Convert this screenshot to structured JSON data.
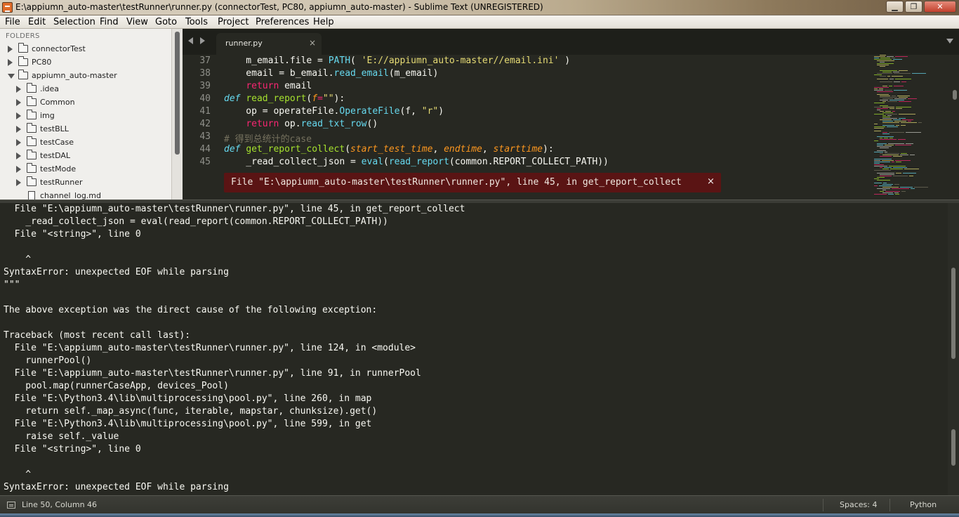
{
  "window": {
    "title": "E:\\appiumn_auto-master\\testRunner\\runner.py (connectorTest, PC80, appiumn_auto-master) - Sublime Text (UNREGISTERED)",
    "min_label": "▁",
    "max_label": "❐",
    "close_label": "✕"
  },
  "menu": [
    "File",
    "Edit",
    "Selection",
    "Find",
    "View",
    "Goto",
    "Tools",
    "Project",
    "Preferences",
    "Help"
  ],
  "sidebar": {
    "header": "FOLDERS",
    "items": [
      {
        "label": "connectorTest",
        "type": "folder",
        "state": "closed"
      },
      {
        "label": "PC80",
        "type": "folder",
        "state": "closed"
      },
      {
        "label": "appiumn_auto-master",
        "type": "folder",
        "state": "open"
      },
      {
        "label": ".idea",
        "type": "folder",
        "state": "closed"
      },
      {
        "label": "Common",
        "type": "folder",
        "state": "closed"
      },
      {
        "label": "img",
        "type": "folder",
        "state": "closed"
      },
      {
        "label": "testBLL",
        "type": "folder",
        "state": "closed"
      },
      {
        "label": "testCase",
        "type": "folder",
        "state": "closed"
      },
      {
        "label": "testDAL",
        "type": "folder",
        "state": "closed"
      },
      {
        "label": "testMode",
        "type": "folder",
        "state": "closed"
      },
      {
        "label": "testRunner",
        "type": "folder",
        "state": "closed"
      },
      {
        "label": "channel_log.md",
        "type": "file",
        "state": "none"
      }
    ]
  },
  "editor": {
    "tab": {
      "label": "runner.py",
      "close": "×"
    },
    "lines": [
      {
        "n": "37",
        "tokens": [
          [
            "    m_email.file = ",
            ""
          ],
          [
            "PATH",
            "cls"
          ],
          [
            "( ",
            ""
          ],
          [
            "'E://appiumn_auto-master//email.ini'",
            "str"
          ],
          [
            " )",
            ""
          ]
        ]
      },
      {
        "n": "38",
        "tokens": [
          [
            "    email = b_email.",
            ""
          ],
          [
            "read_email",
            "cls"
          ],
          [
            "(m_email)",
            ""
          ]
        ]
      },
      {
        "n": "39",
        "tokens": [
          [
            "    ",
            ""
          ],
          [
            "return",
            "kw"
          ],
          [
            " email",
            ""
          ]
        ]
      },
      {
        "n": "40",
        "tokens": [
          [
            "def",
            "kwd"
          ],
          [
            " ",
            ""
          ],
          [
            "read_report",
            "fn"
          ],
          [
            "(",
            ""
          ],
          [
            "f",
            "prm"
          ],
          [
            "=",
            "kw"
          ],
          [
            "\"\"",
            "str"
          ],
          [
            "):",
            ""
          ]
        ]
      },
      {
        "n": "41",
        "tokens": [
          [
            "    op = operateFile.",
            ""
          ],
          [
            "OperateFile",
            "cls"
          ],
          [
            "(f, ",
            ""
          ],
          [
            "\"r\"",
            "str"
          ],
          [
            ")",
            ""
          ]
        ]
      },
      {
        "n": "42",
        "tokens": [
          [
            "    ",
            ""
          ],
          [
            "return",
            "kw"
          ],
          [
            " op.",
            ""
          ],
          [
            "read_txt_row",
            "cls"
          ],
          [
            "()",
            ""
          ]
        ]
      },
      {
        "n": "43",
        "tokens": [
          [
            "# 得到总统计的case",
            "cmt"
          ]
        ]
      },
      {
        "n": "44",
        "tokens": [
          [
            "def",
            "kwd"
          ],
          [
            " ",
            ""
          ],
          [
            "get_report_collect",
            "fn"
          ],
          [
            "(",
            ""
          ],
          [
            "start_test_time",
            "prm"
          ],
          [
            ", ",
            ""
          ],
          [
            "endtime",
            "prm"
          ],
          [
            ", ",
            ""
          ],
          [
            "starttime",
            "prm"
          ],
          [
            "):",
            ""
          ]
        ]
      },
      {
        "n": "45",
        "tokens": [
          [
            "    _read_collect_json = ",
            ""
          ],
          [
            "eval",
            "cls"
          ],
          [
            "(",
            ""
          ],
          [
            "read_report",
            "cls"
          ],
          [
            "(common.REPORT_COLLECT_PATH))",
            ""
          ]
        ]
      }
    ],
    "error_phantom": {
      "text": "File \"E:\\appiumn_auto-master\\testRunner\\runner.py\", line 45, in get_report_collect",
      "close": "×"
    }
  },
  "output": {
    "lines": [
      "  File \"E:\\appiumn_auto-master\\testRunner\\runner.py\", line 45, in get_report_collect",
      "    _read_collect_json = eval(read_report(common.REPORT_COLLECT_PATH))",
      "  File \"<string>\", line 0",
      "",
      "    ^",
      "SyntaxError: unexpected EOF while parsing",
      "\"\"\"",
      "",
      "The above exception was the direct cause of the following exception:",
      "",
      "Traceback (most recent call last):",
      "  File \"E:\\appiumn_auto-master\\testRunner\\runner.py\", line 124, in <module>",
      "    runnerPool()",
      "  File \"E:\\appiumn_auto-master\\testRunner\\runner.py\", line 91, in runnerPool",
      "    pool.map(runnerCaseApp, devices_Pool)",
      "  File \"E:\\Python3.4\\lib\\multiprocessing\\pool.py\", line 260, in map",
      "    return self._map_async(func, iterable, mapstar, chunksize).get()",
      "  File \"E:\\Python3.4\\lib\\multiprocessing\\pool.py\", line 599, in get",
      "    raise self._value",
      "  File \"<string>\", line 0",
      "",
      "    ^",
      "SyntaxError: unexpected EOF while parsing"
    ]
  },
  "status": {
    "position": "Line 50, Column 46",
    "indentation": "Spaces: 4",
    "syntax": "Python"
  },
  "colors": {
    "background": "#272822",
    "keyword": "#f92672",
    "function": "#a6e22e",
    "string": "#e6db74",
    "builtin": "#66d9ef",
    "parameter": "#fd971f",
    "comment": "#75715e",
    "error_bg": "#5a1414"
  }
}
